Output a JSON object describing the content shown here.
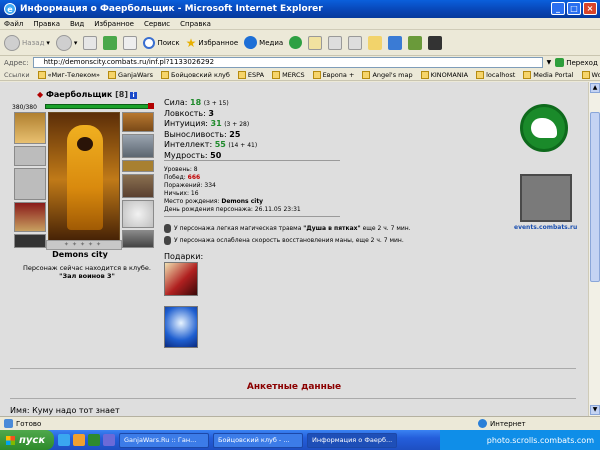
{
  "window": {
    "title": "Информация о Фаербольщик - Microsoft Internet Explorer"
  },
  "menu": [
    "Файл",
    "Правка",
    "Вид",
    "Избранное",
    "Сервис",
    "Справка"
  ],
  "toolbar": {
    "back": "Назад",
    "search": "Поиск",
    "favorites": "Избранное",
    "media": "Медиа"
  },
  "address": {
    "label": "Адрес:",
    "url": "http://demonscity.combats.ru/inf.pl?1133026292",
    "go": "Переход"
  },
  "links": {
    "label": "Ссылки",
    "items": [
      "«Миг-Телеком»",
      "GanjaWars",
      "Бойцовский клуб",
      "ESPA",
      "MERCS",
      "Европа +",
      "Angel's map",
      "KINOMANIA",
      "localhost",
      "Media Portal",
      "WoW migtel"
    ]
  },
  "character": {
    "name": "Фаербольщик",
    "level": "[8]",
    "hp": "380/380",
    "location": "Demons city",
    "location_note": "Персонаж сейчас находится в клубе.",
    "room": "\"Зал воинов 3\""
  },
  "stats": [
    {
      "label": "Сила:",
      "value": "18",
      "bonus": "(3 + 15)",
      "green": true
    },
    {
      "label": "Ловкость:",
      "value": "3",
      "bonus": "",
      "green": false
    },
    {
      "label": "Интуиция:",
      "value": "31",
      "bonus": "(3 + 28)",
      "green": true
    },
    {
      "label": "Выносливость:",
      "value": "25",
      "bonus": "",
      "green": false
    },
    {
      "label": "Интеллект:",
      "value": "55",
      "bonus": "(14 + 41)",
      "green": true
    },
    {
      "label": "Мудрость:",
      "value": "50",
      "bonus": "",
      "green": false
    }
  ],
  "bio": {
    "level": "Уровень: 8",
    "wins_label": "Побед:",
    "wins": "666",
    "losses": "Поражений: 334",
    "draws": "Ничьих: 16",
    "birthplace_label": "Место рождения:",
    "birthplace": "Demons city",
    "birthday": "День рождения персонажа: 26.11.05 23:31"
  },
  "effects": [
    {
      "pre": "У персонажа легкая магическая травма ",
      "bold": "\"Душа в пятках\"",
      "post": " еще 2 ч. 7 мин."
    },
    {
      "pre": "У персонажа ослаблена скорость восстановления маны, еще 2 ч. 7 мин.",
      "bold": "",
      "post": ""
    }
  ],
  "gifts": {
    "label": "Подарки:"
  },
  "sidebar": {
    "banner_label": "events.combats.ru"
  },
  "anket": {
    "title": "Анкетные данные",
    "name_line": "Имя: Куму надо тот знает"
  },
  "status": {
    "text": "Готово",
    "zone": "Интернет"
  },
  "taskbar": {
    "start": "пуск",
    "tasks": [
      "GanjaWars.Ru :: Ган...",
      "Бойцовский клуб - ...",
      "Информация о Фаерб..."
    ],
    "watermark": "photo.scrolls.combats.com"
  }
}
